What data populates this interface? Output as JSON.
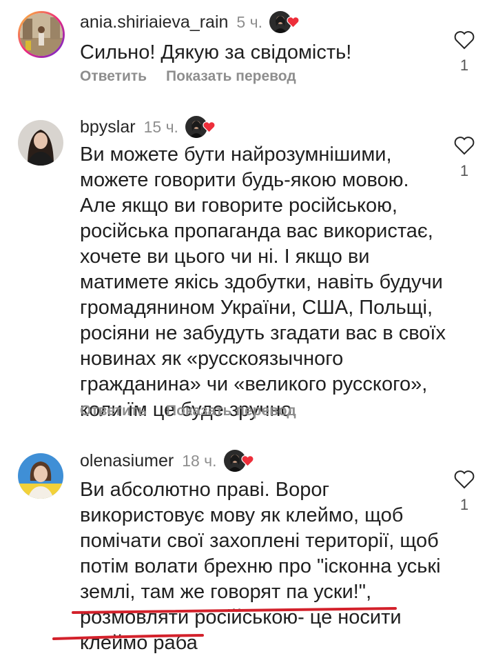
{
  "comments": [
    {
      "username": "ania.shiriaieva_rain",
      "time": "5 ч.",
      "text": "Сильно! Дякую за свідомість!",
      "reply_label": "Ответить",
      "translate_label": "Показать перевод",
      "like_count": "1"
    },
    {
      "username": "bpyslar",
      "time": "15 ч.",
      "text": "Ви можете бути найрозумнішими,\nможете говорити будь-якою мовою.\nАле якщо ви говорите російською,\nросійська пропаганда вас використає,\nхочете ви цього чи ні. І якщо ви\nматимете якісь здобутки, навіть будучи\nгромадянином України, США, Польщі,\nросіяни не забудуть згадати вас в своїх\nновинах як «русскоязычного\nгражданина» чи «великого русского»,\nколи їм це буде зручно.",
      "reply_label": "Ответить",
      "translate_label": "Показать перевод",
      "like_count": "1"
    },
    {
      "username": "olenasiumer",
      "time": "18 ч.",
      "text": "Ви абсолютно праві. Ворог\nвикористовує мову як клеймо, щоб\nпомічати свої захоплені території,  щоб\nпотім волати брехню про \"ісконна уські\nземлі, там же говорят па уски!\",\nрозмовляти російською- це носити\nклеймо раба",
      "like_count": "1"
    }
  ],
  "colors": {
    "heart_red": "#ed2e3a",
    "underline_red": "#d3212b",
    "muted_text": "#8e8e8e"
  },
  "icons": {
    "like": "heart-outline-icon",
    "author_like": "heart-filled-icon"
  }
}
